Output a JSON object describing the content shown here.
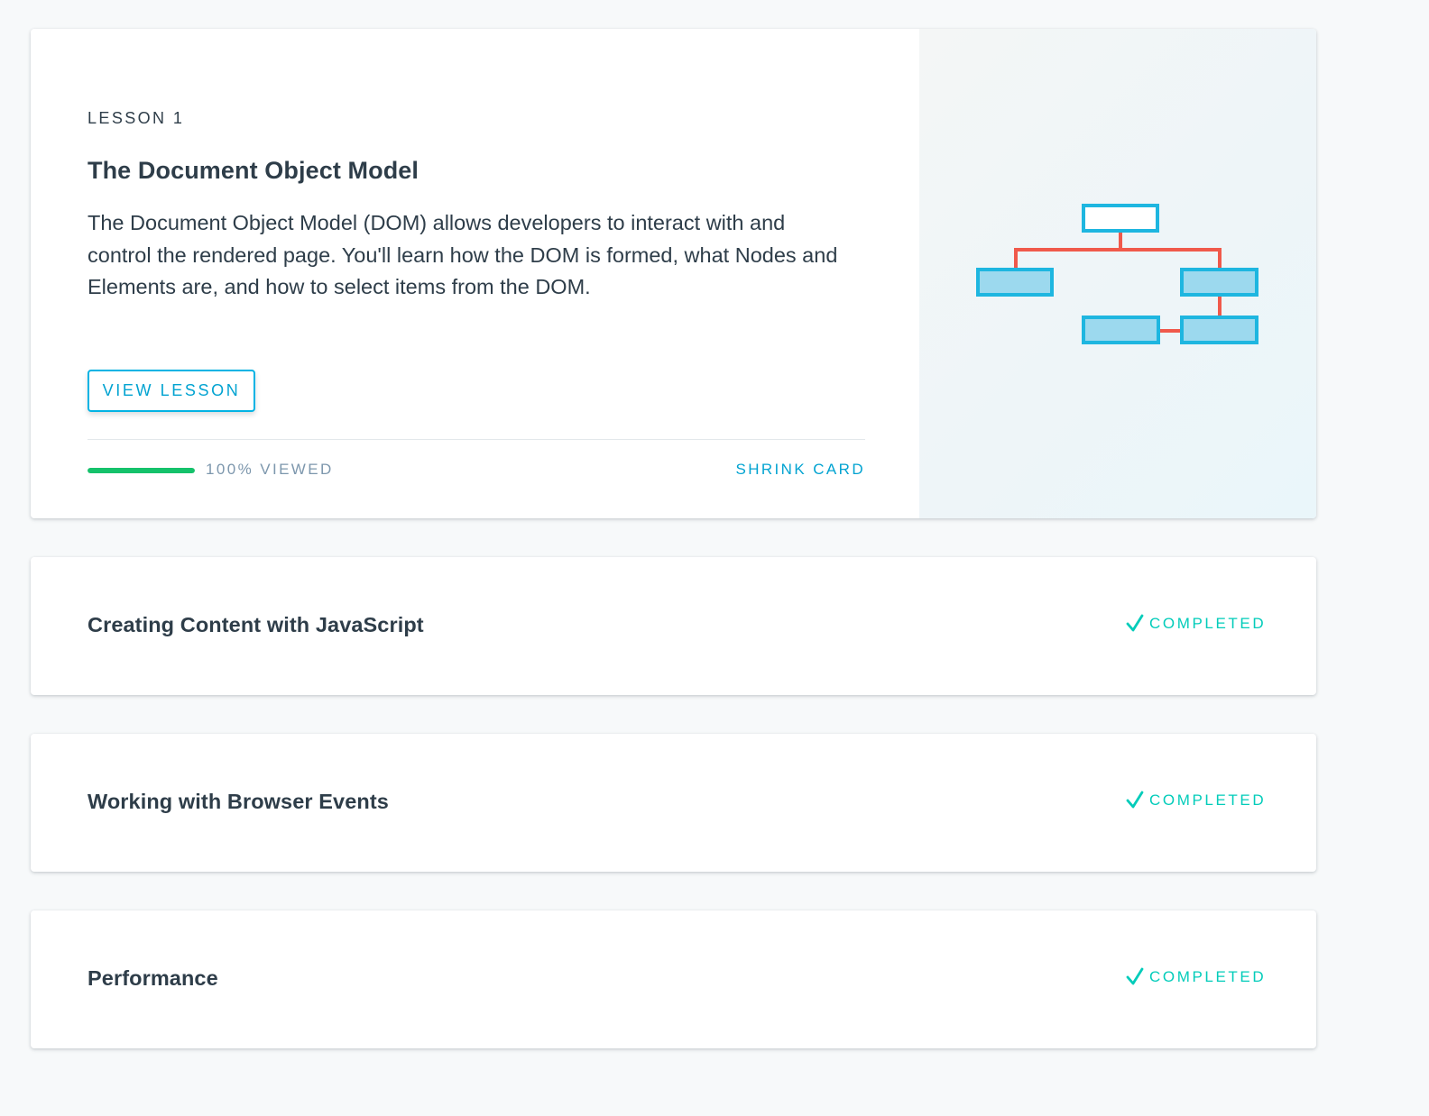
{
  "lessons": {
    "current": {
      "eyebrow": "LESSON 1",
      "title": "The Document Object Model",
      "description": "The Document Object Model (DOM) allows developers to interact with and control the rendered page. You'll learn how the DOM is formed, what Nodes and Elements are, and how to select items from the DOM.",
      "view_button_label": "VIEW LESSON",
      "progress_percent": 100,
      "progress_label": "100% VIEWED",
      "shrink_label": "SHRINK CARD",
      "illustration_icon": "dom-tree-icon"
    },
    "collapsed": [
      {
        "title": "Creating Content with JavaScript",
        "status": "COMPLETED",
        "status_icon": "checkmark-icon"
      },
      {
        "title": "Working with Browser Events",
        "status": "COMPLETED",
        "status_icon": "checkmark-icon"
      },
      {
        "title": "Performance",
        "status": "COMPLETED",
        "status_icon": "checkmark-icon"
      }
    ]
  },
  "colors": {
    "accent_blue": "#02b3e4",
    "progress_green": "#15c26b",
    "completed_teal": "#02ccba",
    "tree_connector": "#f0594b",
    "text_dark": "#2e3d49",
    "text_muted": "#7d97ad"
  }
}
